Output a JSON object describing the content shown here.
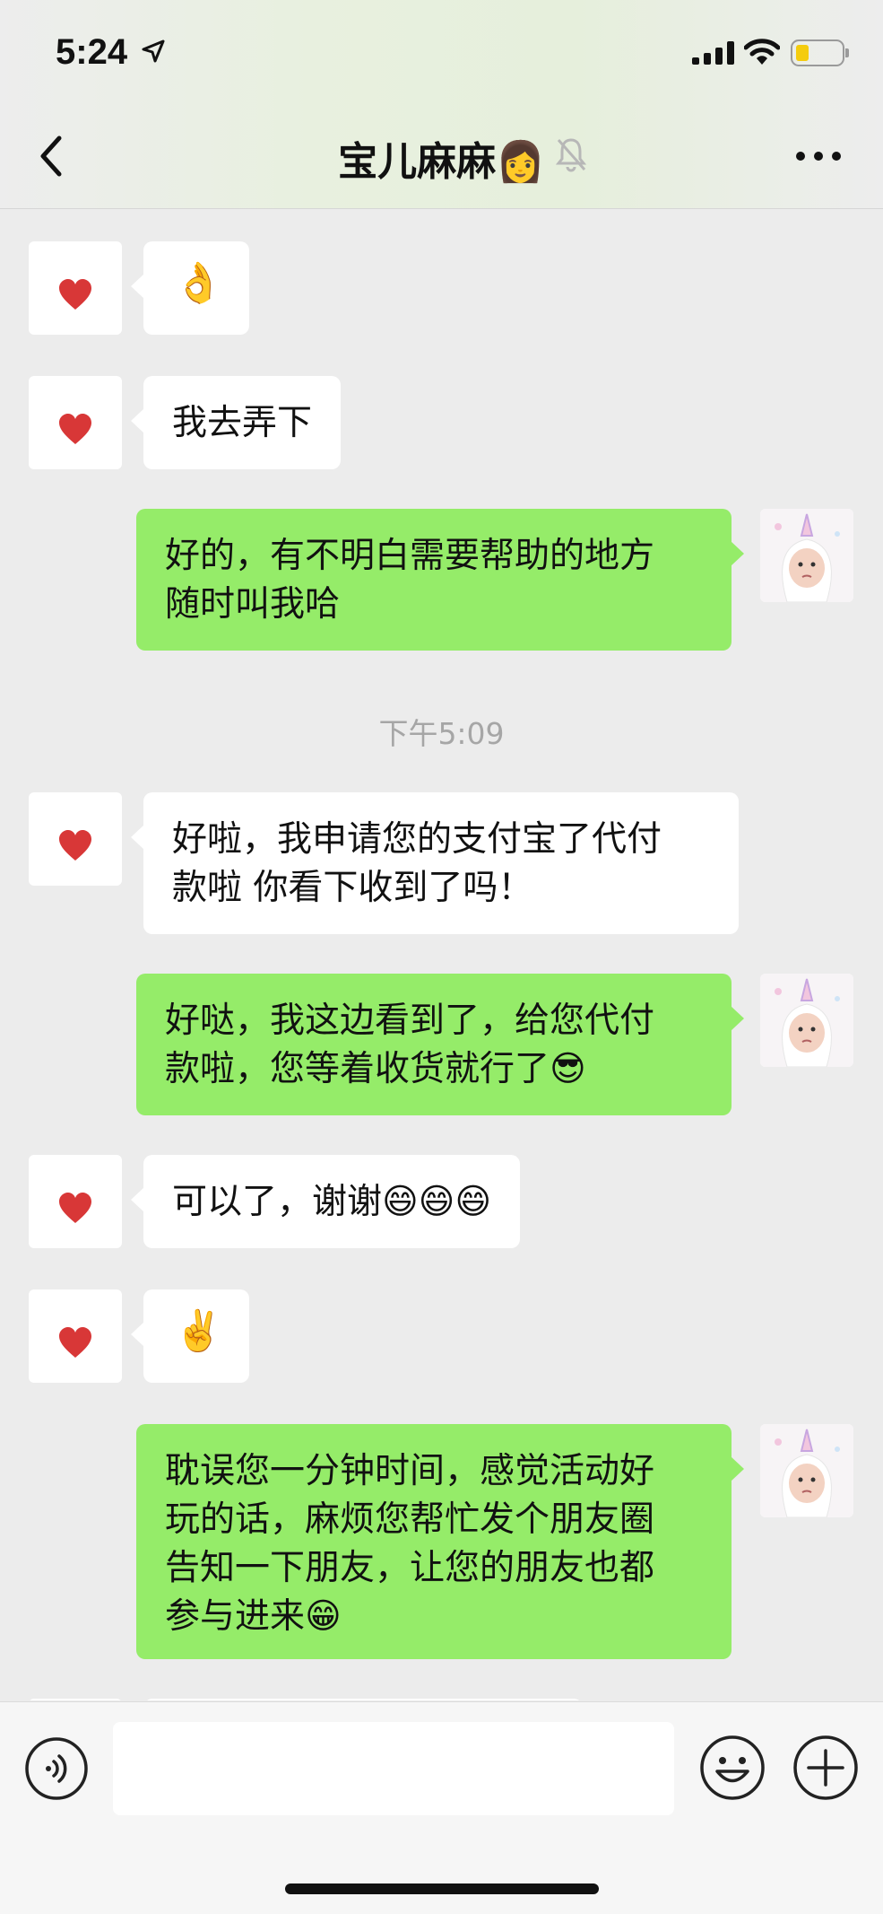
{
  "status_bar": {
    "time": "5:24"
  },
  "header": {
    "title": "宝儿麻麻👩",
    "back_icon": "chevron-left-icon",
    "more_icon": "more-dots-icon"
  },
  "messages": [
    {
      "side": "left",
      "text": "👌"
    },
    {
      "side": "left",
      "text": "我去弄下"
    },
    {
      "side": "right",
      "lines": [
        "好的，有不明白需要帮助的地方",
        "随时叫我哈"
      ]
    },
    {
      "type": "timestamp",
      "text": "下午5:09"
    },
    {
      "side": "left",
      "lines": [
        "好啦，我申请您的支付宝了代付",
        "款啦 你看下收到了吗！"
      ]
    },
    {
      "side": "right",
      "lines": [
        "好哒，我这边看到了，给您代付",
        "款啦，您等着收货就行了😎"
      ]
    },
    {
      "side": "left",
      "text": "可以了，谢谢😄😄😄"
    },
    {
      "side": "left",
      "text": "✌️"
    },
    {
      "side": "right",
      "lines": [
        "耽误您一分钟时间，感觉活动好",
        "玩的话，麻烦您帮忙发个朋友圈",
        "告知一下朋友，让您的朋友也都",
        "参与进来😁"
      ]
    }
  ],
  "input_bar": {
    "placeholder": ""
  },
  "colors": {
    "self_bubble": "#95ec69",
    "other_bubble": "#ffffff",
    "background": "#ececec"
  }
}
